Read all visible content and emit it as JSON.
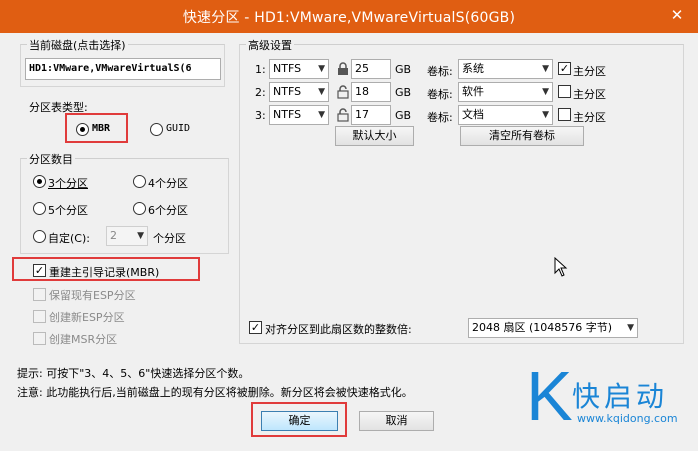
{
  "window": {
    "title": "快速分区 - HD1:VMware,VMwareVirtualS(60GB)",
    "close": "✕"
  },
  "disk": {
    "group_label": "当前磁盘(点击选择)",
    "value": "HD1:VMware,VMwareVirtualS(6"
  },
  "partition_table": {
    "label": "分区表类型:",
    "options": [
      "MBR",
      "GUID"
    ],
    "selected": "MBR"
  },
  "partition_count": {
    "group_label": "分区数目",
    "options": [
      "3个分区",
      "4个分区",
      "5个分区",
      "6个分区"
    ],
    "selected": "3个分区",
    "custom_label": "自定(C):",
    "custom_value": "2",
    "custom_suffix": "个分区"
  },
  "rebuild_mbr": {
    "label": "重建主引导记录(MBR)",
    "checked": true
  },
  "disabled_options": [
    "保留现有ESP分区",
    "创建新ESP分区",
    "创建MSR分区"
  ],
  "advanced": {
    "group_label": "高级设置",
    "rows": [
      {
        "index": "1:",
        "fs": "NTFS",
        "size": "25",
        "unit": "GB",
        "vol_label_text": "卷标:",
        "volume": "系统",
        "primary_label": "主分区",
        "primary": true
      },
      {
        "index": "2:",
        "fs": "NTFS",
        "size": "18",
        "unit": "GB",
        "vol_label_text": "卷标:",
        "volume": "软件",
        "primary_label": "主分区",
        "primary": false
      },
      {
        "index": "3:",
        "fs": "NTFS",
        "size": "17",
        "unit": "GB",
        "vol_label_text": "卷标:",
        "volume": "文档",
        "primary_label": "主分区",
        "primary": false
      }
    ],
    "default_size_button": "默认大小",
    "clear_labels_button": "清空所有卷标",
    "align_label": "对齐分区到此扇区数的整数倍:",
    "align_checked": true,
    "align_value": "2048 扇区 (1048576 字节)"
  },
  "hints": {
    "tip": "提示: 可按下\"3、4、5、6\"快速选择分区个数。",
    "note": "注意: 此功能执行后,当前磁盘上的现有分区将被删除。新分区将会被快速格式化。"
  },
  "buttons": {
    "ok": "确定",
    "cancel": "取消"
  },
  "watermark": {
    "letter": "K",
    "brand": "快启动",
    "url": "www.kqidong.com"
  },
  "colors": {
    "titlebar": "#e05e12",
    "highlight": "#e03b3b",
    "brand": "#1a85d6"
  }
}
